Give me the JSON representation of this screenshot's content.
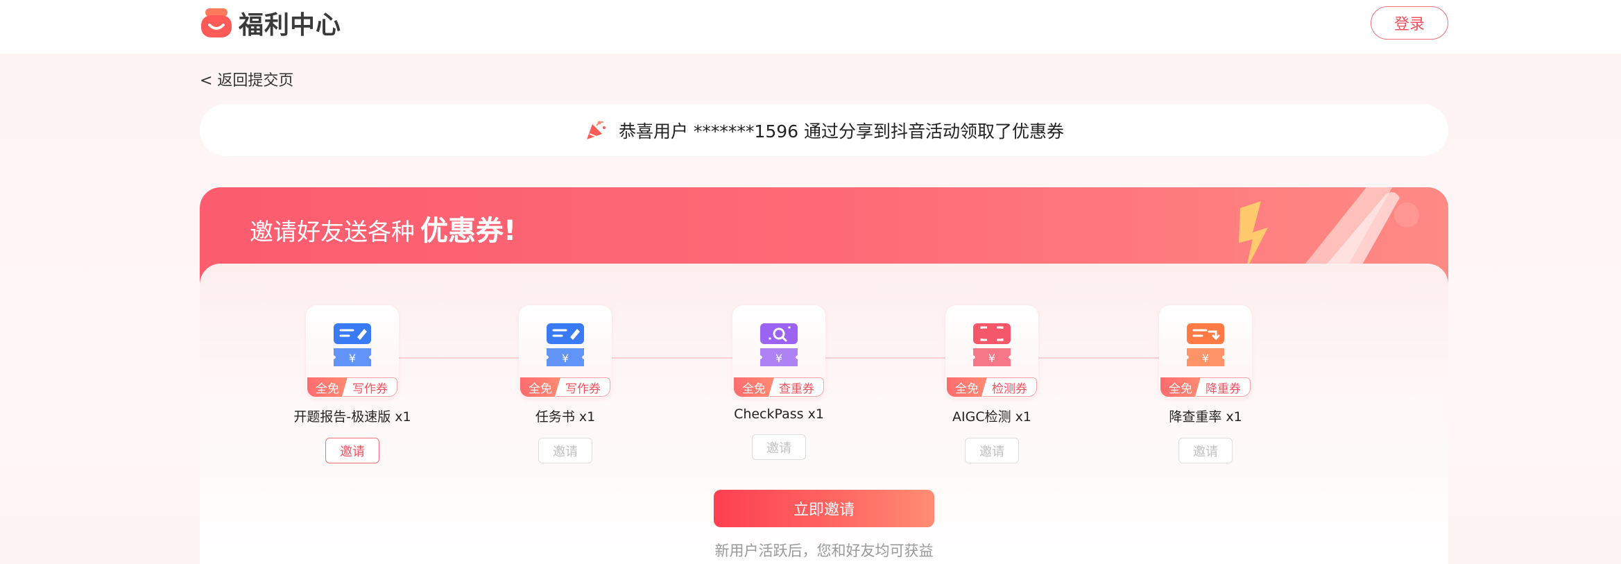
{
  "header": {
    "app_title": "福利中心",
    "login_label": "登录"
  },
  "nav": {
    "back_label": "< 返回提交页"
  },
  "notice": {
    "icon": "party-popper-icon",
    "text": "恭喜用户 *******1596 通过分享到抖音活动领取了优惠券"
  },
  "invite": {
    "title_prefix": "邀请好友送各种",
    "title_strong": "优惠券!",
    "coupons": [
      {
        "badge": "全免",
        "type": "写作券",
        "name": "开题报告-极速版 x1",
        "button": "邀请",
        "enabled": true,
        "icon": "pen-ticket-icon",
        "color": "#3a7af5"
      },
      {
        "badge": "全免",
        "type": "写作券",
        "name": "任务书 x1",
        "button": "邀请",
        "enabled": false,
        "icon": "pen-ticket-icon",
        "color": "#3a7af5"
      },
      {
        "badge": "全免",
        "type": "查重券",
        "name": "CheckPass x1",
        "button": "邀请",
        "enabled": false,
        "icon": "search-ticket-icon",
        "color": "#9a63f2"
      },
      {
        "badge": "全免",
        "type": "检测券",
        "name": "AIGC检测 x1",
        "button": "邀请",
        "enabled": false,
        "icon": "scan-ticket-icon",
        "color": "#f4566a"
      },
      {
        "badge": "全免",
        "type": "降重券",
        "name": "降查重率 x1",
        "button": "邀请",
        "enabled": false,
        "icon": "reduce-ticket-icon",
        "color": "#ff7a45"
      }
    ],
    "cta_label": "立即邀请",
    "hint": "新用户活跃后，您和好友均可获益"
  },
  "colors": {
    "accent": "#f0505c",
    "banner_start": "#fb5c6e",
    "banner_end": "#fe8a84"
  }
}
